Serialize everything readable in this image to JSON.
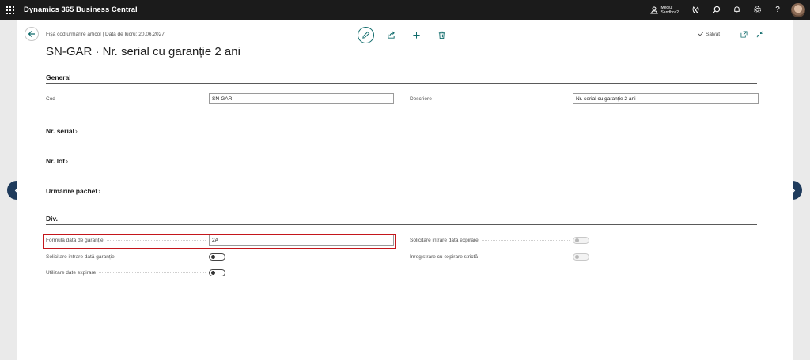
{
  "appbar": {
    "title": "Dynamics 365 Business Central",
    "environment_line1": "Mediu:",
    "environment_line2": "Sandbox2"
  },
  "page": {
    "breadcrumb": "Fișă cod urmărire articol | Dată de lucru: 20.06.2027",
    "title": "SN-GAR · Nr. serial cu garanție 2 ani",
    "saved_label": "Salvat"
  },
  "sections": {
    "general": "General",
    "serial": "Nr. serial",
    "lot": "Nr. lot",
    "package": "Urmărire pachet",
    "misc": "Div."
  },
  "general": {
    "code_label": "Cod",
    "code_value": "SN-GAR",
    "description_label": "Descriere",
    "description_value": "Nr. serial cu garanție 2 ani"
  },
  "misc": {
    "warranty_formula_label": "Formulă dată de garanție",
    "warranty_formula_value": "2A",
    "require_warranty_label": "Solicitare intrare dată garanției",
    "require_warranty_on": false,
    "use_expiration_label": "Utilizare date expirare",
    "use_expiration_on": false,
    "require_expiration_label": "Solicitare intrare dată expirare",
    "require_expiration_on": false,
    "strict_expiration_label": "Înregistrare cu expirare strictă",
    "strict_expiration_on": false
  },
  "icons": [
    "waffle-icon",
    "environment-icon",
    "copilot-icon",
    "search-icon",
    "bell-icon",
    "gear-icon",
    "help-icon",
    "back-arrow-icon",
    "edit-pencil-icon",
    "share-icon",
    "plus-icon",
    "trash-icon",
    "check-icon",
    "open-in-new-icon",
    "collapse-icon",
    "chevron-left-icon",
    "chevron-right-icon"
  ],
  "colors": {
    "appbar": "#1b1b1b",
    "accent": "#0f6b6b",
    "highlight": "#c4161c",
    "nav_arrow": "#1f3b5c"
  }
}
